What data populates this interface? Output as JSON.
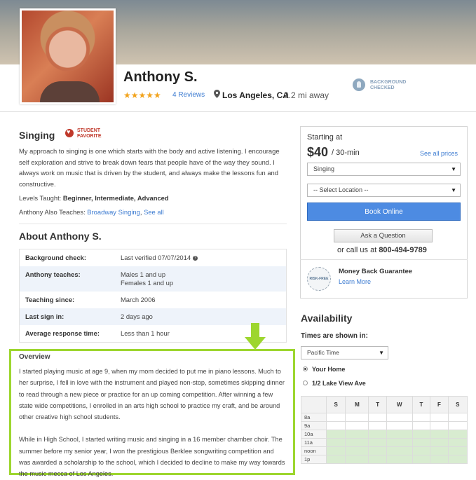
{
  "profile": {
    "name": "Anthony S.",
    "stars": "★★★★★",
    "reviews": "4 Reviews",
    "location": "Los Angeles, CA",
    "distance": "9.2 mi away",
    "background_badge": "BACKGROUND\nCHECKED"
  },
  "subject": {
    "title": "Singing",
    "badge": "STUDENT\nFAVORITE",
    "description": "My approach to singing is one which starts with the body and active listening. I encourage self exploration and strive to break down fears that people have of the way they sound. I always work on music that is driven by the student, and always make the lessons fun and constructive.",
    "levels_label": "Levels Taught: ",
    "levels_value": "Beginner, Intermediate, Advanced",
    "also_label": "Anthony Also Teaches: ",
    "also_link1": "Broadway Singing",
    "also_sep": ", ",
    "also_link2": "See all"
  },
  "about": {
    "title": "About Anthony S.",
    "rows": [
      {
        "k": "Background check:",
        "v": "Last verified 07/07/2014"
      },
      {
        "k": "Anthony teaches:",
        "v": "Males 1 and up",
        "v2": "Females 1 and up"
      },
      {
        "k": "Teaching since:",
        "v": "March 2006"
      },
      {
        "k": "Last sign in:",
        "v": "2 days ago"
      },
      {
        "k": "Average response time:",
        "v": "Less than 1 hour"
      }
    ]
  },
  "overview": {
    "title": "Overview",
    "p1": "I started playing music at age 9, when my mom decided to put me in piano lessons. Much to her surprise, I fell in love with the instrument and played non-stop, sometimes skipping dinner to read through a new piece or practice for an up coming competition. After winning a few state wide competitions, I enrolled in an arts high school to practice my craft, and be around other creative high school students.",
    "p2": "While in High School, I started writing music and singing in a 16 member chamber choir. The summer before my senior year, I won the prestigious Berklee songwriting competition and was awarded a scholarship to the school, which I decided to decline to make my way towards the music mecca of Los Angeles."
  },
  "booking": {
    "starting_at": "Starting at",
    "price": "$40",
    "per": " / 30-min",
    "see_all_prices": "See all prices",
    "subject_select": "Singing",
    "location_select": "-- Select Location --",
    "book_online": "Book Online",
    "ask_question": "Ask a Question",
    "call_prefix": "or call us at ",
    "phone": "800-494-9789",
    "badge_text": "RISK-FREE",
    "mbg_title": "Money Back Guarantee",
    "learn_more": "Learn More"
  },
  "availability": {
    "title": "Availability",
    "times_shown": "Times are shown in:",
    "timezone": "Pacific Time",
    "opt1": "Your Home",
    "opt2": "1/2 Lake View Ave",
    "days": [
      "S",
      "M",
      "T",
      "W",
      "T",
      "F",
      "S"
    ],
    "times": [
      "8a",
      "9a",
      "10a",
      "11a",
      "noon",
      "1p"
    ]
  },
  "colors": {
    "accent_blue": "#4d8be2",
    "link_blue": "#3c7bd1",
    "highlight_green": "#9dd62f",
    "star_orange": "#f2a31c",
    "favorite_red": "#c0392b"
  }
}
